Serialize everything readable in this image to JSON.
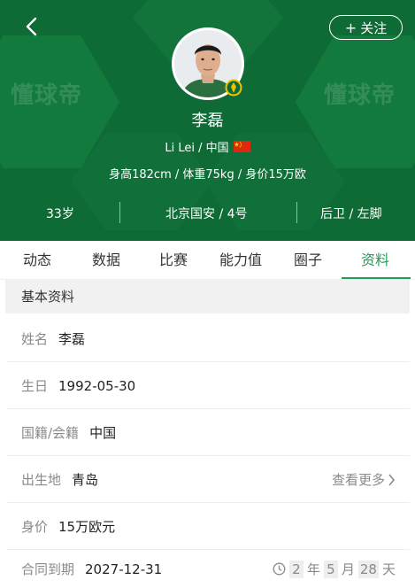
{
  "header": {
    "back_icon": "back-chevron-icon",
    "follow_label": "关注",
    "watermark_text": "懂球帝",
    "player_name": "李磊",
    "english_name_country": "Li Lei / 中国",
    "flag_icon": "china-flag-icon",
    "body_stats": "身高182cm / 体重75kg / 身价15万欧",
    "age": "33岁",
    "club_number": "北京国安 / 4号",
    "position_foot": "后卫 / 左脚",
    "bg_color": "#0f6b35"
  },
  "tabs": [
    {
      "label": "动态"
    },
    {
      "label": "数据"
    },
    {
      "label": "比赛"
    },
    {
      "label": "能力值"
    },
    {
      "label": "圈子"
    },
    {
      "label": "资料"
    }
  ],
  "active_tab": "资料",
  "accent_color": "#1f9e55",
  "profile": {
    "section_title": "基本资料",
    "name": {
      "label": "姓名",
      "value": "李磊"
    },
    "birthday": {
      "label": "生日",
      "value": "1992-05-30"
    },
    "nationality": {
      "label": "国籍/会籍",
      "value": "中国"
    },
    "birthplace": {
      "label": "出生地",
      "value": "青岛",
      "more": "查看更多"
    },
    "value": {
      "label": "身价",
      "value": "15万欧元"
    },
    "contract": {
      "label": "合同到期",
      "value": "2027-12-31",
      "clock_icon": "clock-icon",
      "remaining": {
        "years": "2",
        "year_unit": "年",
        "months": "5",
        "month_unit": "月",
        "days": "28",
        "day_unit": "天"
      }
    }
  }
}
